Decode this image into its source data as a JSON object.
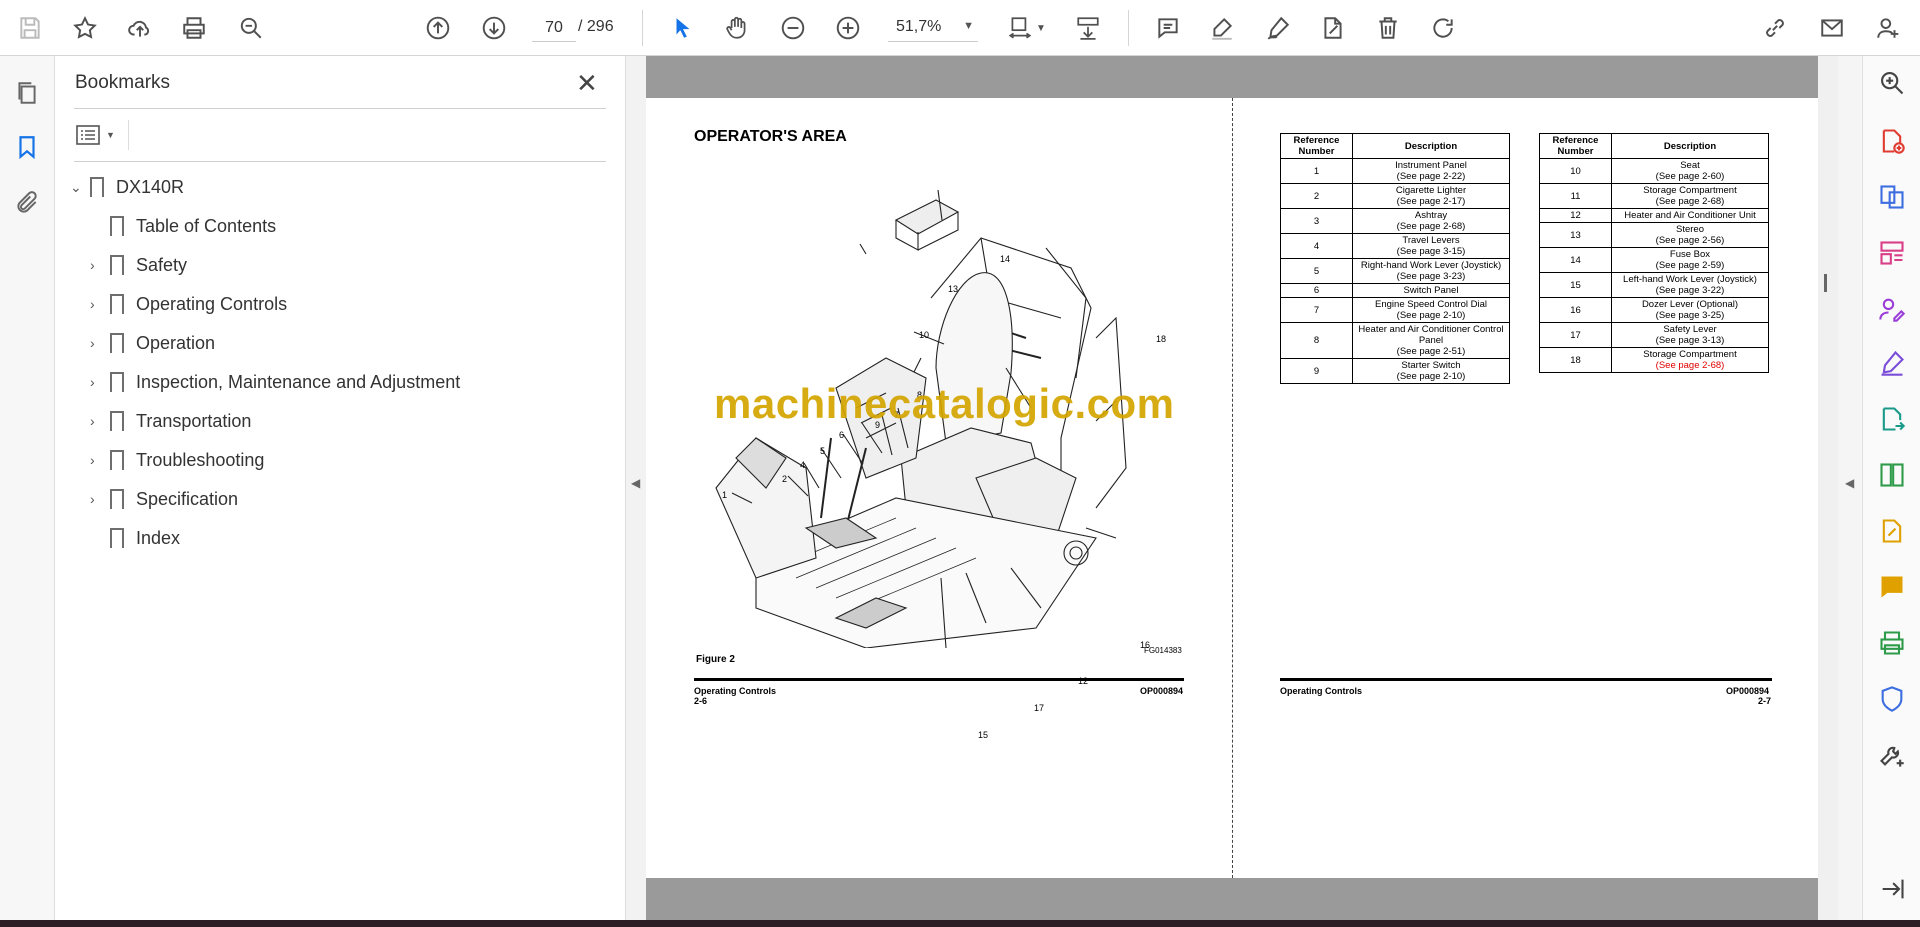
{
  "toolbar": {
    "page_current": "70",
    "page_total": "/ 296",
    "zoom": "51,7%"
  },
  "bookmarks": {
    "title": "Bookmarks",
    "items": [
      {
        "label": "DX140R",
        "level": 0,
        "expanded": true
      },
      {
        "label": "Table of Contents",
        "level": 1,
        "expandable": false
      },
      {
        "label": "Safety",
        "level": 1,
        "expandable": true
      },
      {
        "label": "Operating Controls",
        "level": 1,
        "expandable": true
      },
      {
        "label": "Operation",
        "level": 1,
        "expandable": true
      },
      {
        "label": "Inspection, Maintenance and Adjustment",
        "level": 1,
        "expandable": true
      },
      {
        "label": "Transportation",
        "level": 1,
        "expandable": true
      },
      {
        "label": "Troubleshooting",
        "level": 1,
        "expandable": true
      },
      {
        "label": "Specification",
        "level": 1,
        "expandable": true
      },
      {
        "label": "Index",
        "level": 1,
        "expandable": false
      }
    ]
  },
  "document": {
    "left_page": {
      "title": "OPERATOR'S AREA",
      "figure_label": "Figure 2",
      "figure_code": "FG014383",
      "callouts": [
        "1",
        "2",
        "4",
        "5",
        "6",
        "7",
        "8",
        "9",
        "10",
        "12",
        "13",
        "14",
        "15",
        "16",
        "17",
        "18"
      ],
      "footer_left": "Operating Controls",
      "footer_page": "2-6",
      "footer_right": "OP000894"
    },
    "right_page": {
      "col_header_ref": "Reference Number",
      "col_header_desc": "Description",
      "table1": [
        {
          "ref": "1",
          "desc": "Instrument Panel",
          "see": "(See page 2-22)"
        },
        {
          "ref": "2",
          "desc": "Cigarette Lighter",
          "see": "(See page 2-17)"
        },
        {
          "ref": "3",
          "desc": "Ashtray",
          "see": "(See page 2-68)"
        },
        {
          "ref": "4",
          "desc": "Travel Levers",
          "see": "(See page 3-15)"
        },
        {
          "ref": "5",
          "desc": "Right-hand Work Lever (Joystick)",
          "see": "(See page 3-23)"
        },
        {
          "ref": "6",
          "desc": "Switch Panel",
          "see": ""
        },
        {
          "ref": "7",
          "desc": "Engine Speed Control Dial",
          "see": "(See page 2-10)"
        },
        {
          "ref": "8",
          "desc": "Heater and Air Conditioner Control Panel",
          "see": "(See page 2-51)"
        },
        {
          "ref": "9",
          "desc": "Starter Switch",
          "see": "(See page 2-10)"
        }
      ],
      "table2": [
        {
          "ref": "10",
          "desc": "Seat",
          "see": "(See page 2-60)"
        },
        {
          "ref": "11",
          "desc": "Storage Compartment",
          "see": "(See page 2-68)"
        },
        {
          "ref": "12",
          "desc": "Heater and Air Conditioner Unit",
          "see": ""
        },
        {
          "ref": "13",
          "desc": "Stereo",
          "see": "(See page 2-56)"
        },
        {
          "ref": "14",
          "desc": "Fuse Box",
          "see": "(See page 2-59)"
        },
        {
          "ref": "15",
          "desc": "Left-hand Work Lever (Joystick)",
          "see": "(See page 3-22)"
        },
        {
          "ref": "16",
          "desc": "Dozer Lever (Optional)",
          "see": "(See page 3-25)"
        },
        {
          "ref": "17",
          "desc": "Safety Lever",
          "see": "(See page 3-13)"
        },
        {
          "ref": "18",
          "desc": "Storage Compartment",
          "see": "(See page 2-68)",
          "see_color": "#e00000"
        }
      ],
      "footer_left": "Operating Controls",
      "footer_right": "OP000894",
      "footer_page": "2-7"
    },
    "watermark": "machinecatalogic.com"
  }
}
